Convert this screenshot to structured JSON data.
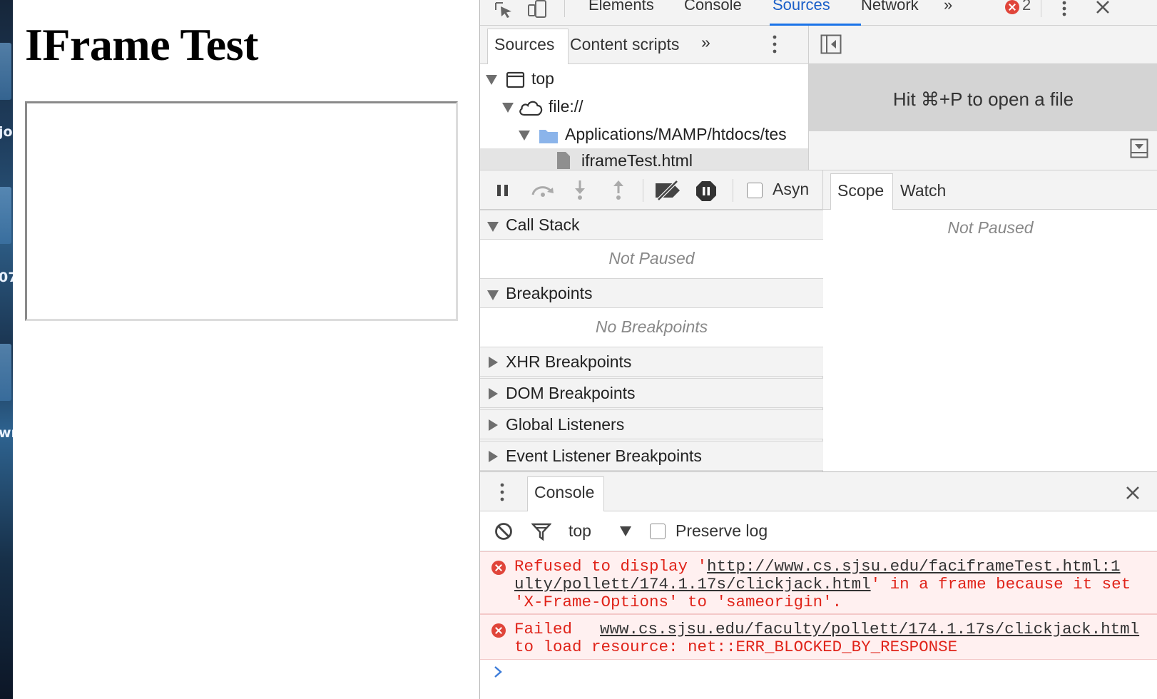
{
  "page": {
    "heading": "IFrame Test"
  },
  "desktop": {
    "fragments": [
      "jo",
      "07",
      "wn"
    ]
  },
  "devtools": {
    "tabs": [
      "Elements",
      "Console",
      "Sources",
      "Network"
    ],
    "active_tab": "Sources",
    "error_count": "2",
    "navigator": {
      "tabs": [
        "Sources",
        "Content scripts"
      ],
      "tree": [
        {
          "label": "top",
          "icon": "frame-icon"
        },
        {
          "label": "file://",
          "icon": "cloud-icon"
        },
        {
          "label": "Applications/MAMP/htdocs/tes",
          "icon": "folder-icon"
        },
        {
          "label": "iframeTest.html",
          "icon": "file-icon"
        }
      ]
    },
    "editor": {
      "hint": "Hit ⌘+P to open a file"
    },
    "debugger": {
      "async_label": "Asyn",
      "sections": [
        {
          "title": "Call Stack",
          "expanded": true,
          "body": "Not Paused"
        },
        {
          "title": "Breakpoints",
          "expanded": true,
          "body": "No Breakpoints"
        },
        {
          "title": "XHR Breakpoints",
          "expanded": false
        },
        {
          "title": "DOM Breakpoints",
          "expanded": false
        },
        {
          "title": "Global Listeners",
          "expanded": false
        },
        {
          "title": "Event Listener Breakpoints",
          "expanded": false
        }
      ],
      "side_tabs": [
        "Scope",
        "Watch"
      ],
      "side_body": "Not Paused"
    },
    "drawer": {
      "tab": "Console",
      "context": "top",
      "preserve_log": "Preserve log",
      "messages": [
        {
          "lines": [
            {
              "pre": "Refused to display '",
              "link": "http://www.cs.sjsu.edu/fac",
              "source": "iframeTest.html:1"
            },
            {
              "link": "ulty/pollett/174.1.17s/clickjack.html",
              "post": "' in a frame because it set"
            },
            {
              "post": "'X-Frame-Options' to 'sameorigin'."
            }
          ]
        },
        {
          "lines": [
            {
              "pre": "Failed",
              "link": "www.cs.sjsu.edu/faculty/pollett/174.1.17s/clickjack.html"
            },
            {
              "post": "to load resource: net::ERR_BLOCKED_BY_RESPONSE"
            }
          ]
        }
      ]
    }
  },
  "colors": {
    "active_tab": "#1a73e8",
    "error": "#e0241a",
    "error_bg": "#fff0f0",
    "panel_bg": "#f3f3f3"
  }
}
